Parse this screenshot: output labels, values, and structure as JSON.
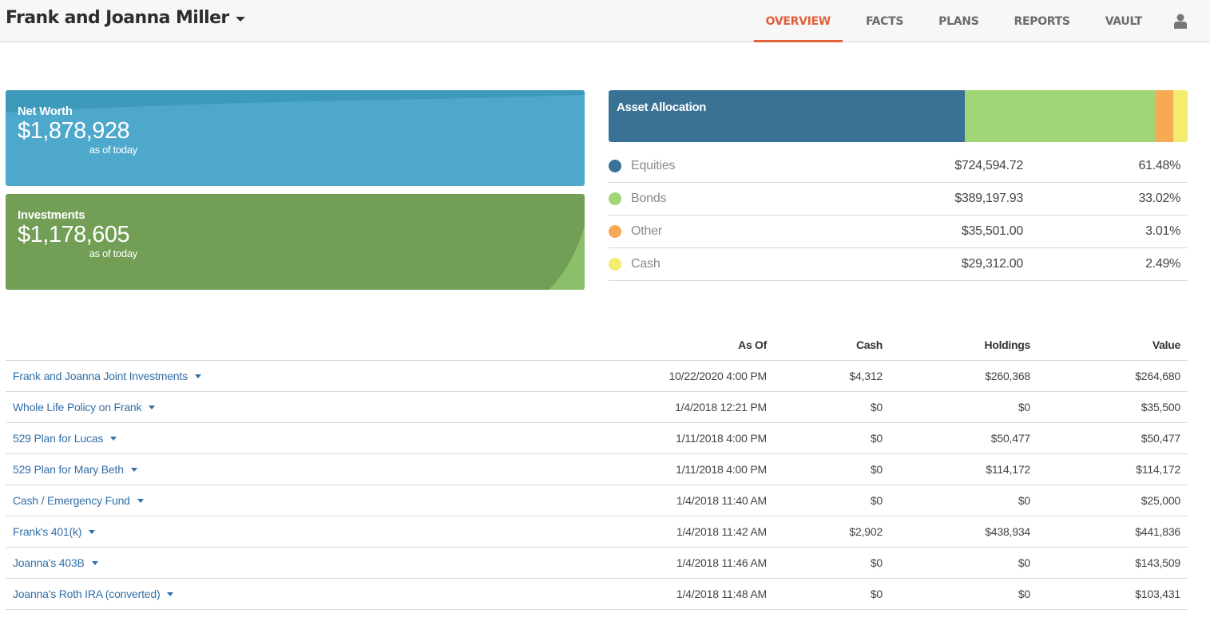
{
  "header": {
    "client_name": "Frank and Joanna Miller",
    "nav_tabs": [
      {
        "label": "OVERVIEW",
        "active": true
      },
      {
        "label": "FACTS",
        "active": false
      },
      {
        "label": "PLANS",
        "active": false
      },
      {
        "label": "REPORTS",
        "active": false
      },
      {
        "label": "VAULT",
        "active": false
      }
    ],
    "user_icon": "user-icon",
    "accent_color": "#e0603a"
  },
  "cards": {
    "net_worth": {
      "title": "Net Worth",
      "value": "$1,878,928",
      "subtitle": "as of today",
      "color": "#4ea8cb"
    },
    "investments": {
      "title": "Investments",
      "value": "$1,178,605",
      "subtitle": "as of today",
      "color": "#729e55"
    }
  },
  "asset_allocation": {
    "title": "Asset Allocation",
    "items": [
      {
        "name": "Equities",
        "amount": "$724,594.72",
        "percent_label": "61.48%",
        "percent": 61.48,
        "color": "#3a7296"
      },
      {
        "name": "Bonds",
        "amount": "$389,197.93",
        "percent_label": "33.02%",
        "percent": 33.02,
        "color": "#a1d676"
      },
      {
        "name": "Other",
        "amount": "$35,501.00",
        "percent_label": "3.01%",
        "percent": 3.01,
        "color": "#f7a955"
      },
      {
        "name": "Cash",
        "amount": "$29,312.00",
        "percent_label": "2.49%",
        "percent": 2.49,
        "color": "#f3ec6f"
      }
    ]
  },
  "accounts": {
    "columns": [
      "",
      "As Of",
      "Cash",
      "Holdings",
      "Value"
    ],
    "rows": [
      {
        "name": "Frank and Joanna Joint Investments",
        "as_of": "10/22/2020 4:00 PM",
        "cash": "$4,312",
        "holdings": "$260,368",
        "value": "$264,680"
      },
      {
        "name": "Whole Life Policy on Frank",
        "as_of": "1/4/2018 12:21 PM",
        "cash": "$0",
        "holdings": "$0",
        "value": "$35,500"
      },
      {
        "name": "529 Plan for Lucas",
        "as_of": "1/11/2018 4:00 PM",
        "cash": "$0",
        "holdings": "$50,477",
        "value": "$50,477"
      },
      {
        "name": "529 Plan for Mary Beth",
        "as_of": "1/11/2018 4:00 PM",
        "cash": "$0",
        "holdings": "$114,172",
        "value": "$114,172"
      },
      {
        "name": "Cash / Emergency Fund",
        "as_of": "1/4/2018 11:40 AM",
        "cash": "$0",
        "holdings": "$0",
        "value": "$25,000"
      },
      {
        "name": "Frank's 401(k)",
        "as_of": "1/4/2018 11:42 AM",
        "cash": "$2,902",
        "holdings": "$438,934",
        "value": "$441,836"
      },
      {
        "name": "Joanna's 403B",
        "as_of": "1/4/2018 11:46 AM",
        "cash": "$0",
        "holdings": "$0",
        "value": "$143,509"
      },
      {
        "name": "Joanna's Roth IRA (converted)",
        "as_of": "1/4/2018 11:48 AM",
        "cash": "$0",
        "holdings": "$0",
        "value": "$103,431"
      }
    ]
  }
}
